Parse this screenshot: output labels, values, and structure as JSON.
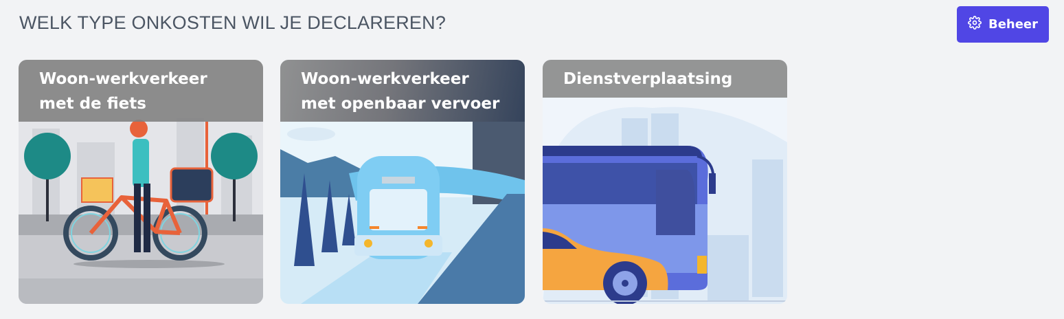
{
  "header": {
    "title": "WELK TYPE ONKOSTEN WIL JE DECLAREREN?",
    "manage_label": "Beheer",
    "manage_icon": "gear-icon",
    "accent_color": "#5046e5"
  },
  "cards": [
    {
      "line1": "Woon-werkverkeer",
      "line2": "met de fiets",
      "illustration": "cyclist-illustration"
    },
    {
      "line1": "Woon-werkverkeer",
      "line2": "met openbaar vervoer",
      "illustration": "train-illustration"
    },
    {
      "line1": "Dienstverplaatsing",
      "line2": "",
      "illustration": "bus-car-illustration"
    }
  ]
}
